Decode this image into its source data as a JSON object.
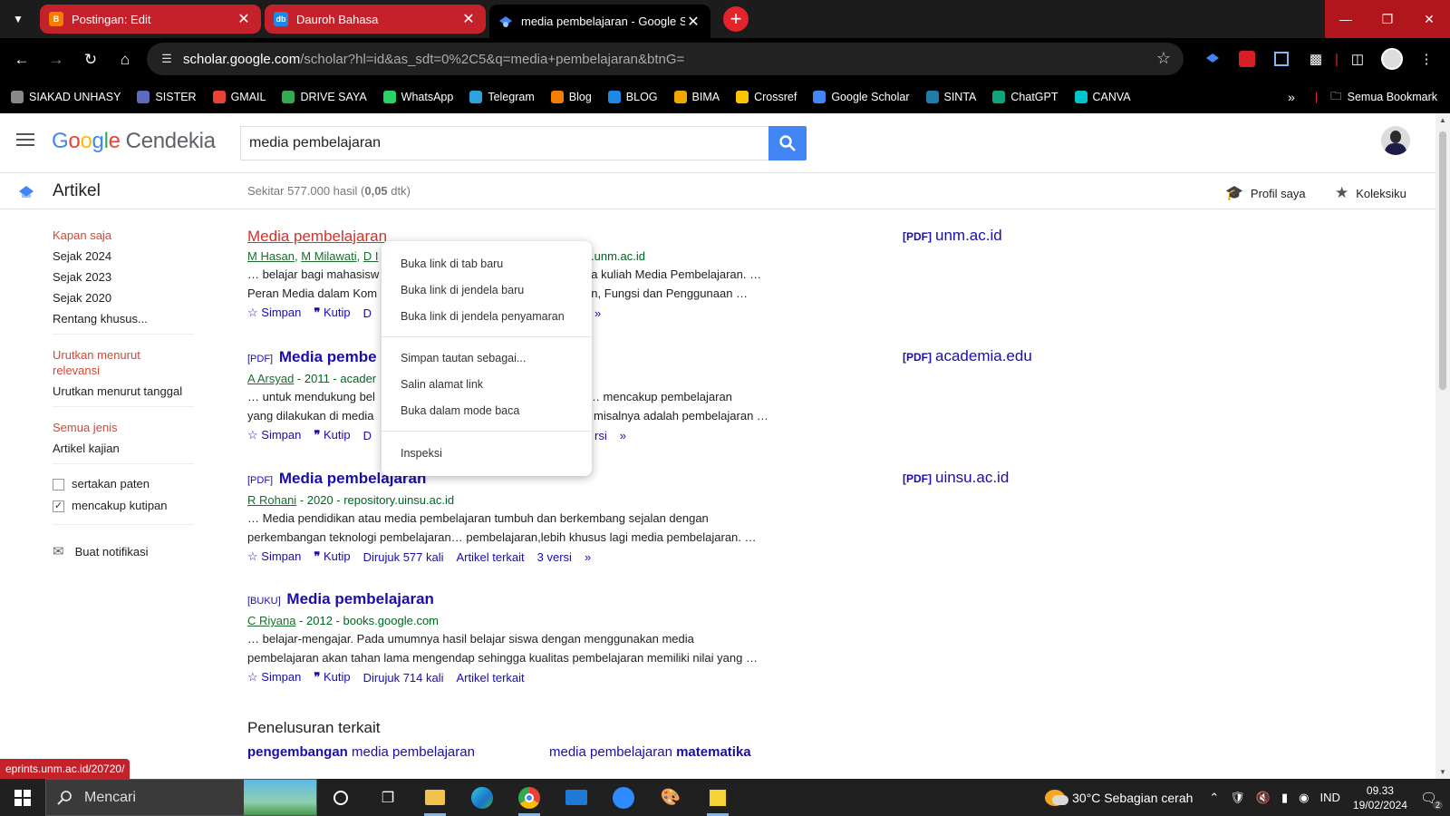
{
  "browser": {
    "tabs": [
      {
        "title": "Postingan: Edit",
        "favicon": "B",
        "color": "#f57d00"
      },
      {
        "title": "Dauroh Bahasa",
        "favicon": "db",
        "color": "#1e88e5"
      },
      {
        "title": "media pembelajaran - Google S",
        "favicon": "scholar",
        "color": "#4285f4"
      }
    ],
    "address": {
      "host": "scholar.google.com",
      "path": "/scholar?hl=id&as_sdt=0%2C5&q=media+pembelajaran&btnG="
    },
    "bookmarks": [
      {
        "label": "SIAKAD UNHASY",
        "icon": "ring-icon",
        "color": "#888"
      },
      {
        "label": "SISTER",
        "icon": "sister-icon",
        "color": "#5c6bc0"
      },
      {
        "label": "GMAIL",
        "icon": "gmail-icon",
        "color": "#ea4335"
      },
      {
        "label": "DRIVE SAYA",
        "icon": "drive-icon",
        "color": "#34a853"
      },
      {
        "label": "WhatsApp",
        "icon": "whatsapp-icon",
        "color": "#25d366"
      },
      {
        "label": "Telegram",
        "icon": "telegram-icon",
        "color": "#2aa3df"
      },
      {
        "label": "Blog",
        "icon": "blogger-icon",
        "color": "#f57d00"
      },
      {
        "label": "BLOG",
        "icon": "db-icon",
        "color": "#1e88e5"
      },
      {
        "label": "BIMA",
        "icon": "bima-icon",
        "color": "#f0a800"
      },
      {
        "label": "Crossref",
        "icon": "crossref-icon",
        "color": "#f7c600"
      },
      {
        "label": "Google Scholar",
        "icon": "scholar-icon",
        "color": "#4285f4"
      },
      {
        "label": "SINTA",
        "icon": "sinta-icon",
        "color": "#1f7ea8"
      },
      {
        "label": "ChatGPT",
        "icon": "chatgpt-icon",
        "color": "#10a37f"
      },
      {
        "label": "CANVA",
        "icon": "canva-icon",
        "color": "#00c4cc"
      }
    ],
    "all_bookmarks": "Semua Bookmark",
    "status_url": "eprints.unm.ac.id/20720/"
  },
  "scholar": {
    "logo": {
      "google": [
        "G",
        "o",
        "o",
        "g",
        "l",
        "e"
      ],
      "suffix": "Cendekia"
    },
    "query": "media pembelajaran",
    "section": "Artikel",
    "count_prefix": "Sekitar 577.000 hasil (",
    "count_time": "0,05",
    "count_suffix": " dtk)",
    "profile": "Profil saya",
    "library": "Koleksiku",
    "nav": {
      "time_active": "Kapan saja",
      "years": [
        "Sejak 2024",
        "Sejak 2023",
        "Sejak 2020",
        "Rentang khusus..."
      ],
      "sort_active": "Urutkan menurut relevansi",
      "sort_date": "Urutkan menurut tanggal",
      "type_active": "Semua jenis",
      "type_review": "Artikel kajian",
      "patents": "sertakan paten",
      "citations": "mencakup kutipan",
      "alert": "Buat notifikasi"
    },
    "results": [
      {
        "tag": "",
        "title": "Media pembelajaran",
        "authors": [
          "M Hasan",
          "M Milawati",
          "D I"
        ],
        "source_tail": "s.unm.ac.id",
        "snip1a": "… belajar bagi mahasisw",
        "snip1b": "a kuliah Media Pembelajaran. …",
        "snip2a": "Peran Media dalam Kom",
        "snip2b": "an, Fungsi dan Penggunaan …",
        "side_tag": "[PDF]",
        "side_domain": "unm.ac.id"
      },
      {
        "tag": "[PDF]",
        "title": "Media pembe",
        "author": "A Arsyad",
        "source": " - 2011 - acader",
        "snip1a": "… untuk mendukung bel",
        "snip1b": "… mencakup pembelajaran",
        "snip2a": "yang dilakukan di media",
        "snip2b": "l misalnya adalah pembelajaran …",
        "versions_tail": "rsi",
        "side_tag": "[PDF]",
        "side_domain": "academia.edu"
      },
      {
        "tag": "[PDF]",
        "title": "Media pembelajaran",
        "author": "R Rohani",
        "source": " - 2020 - repository.uinsu.ac.id",
        "snip1": "… Media pendidikan atau media pembelajaran tumbuh dan berkembang sejalan dengan",
        "snip2": "perkembangan teknologi pembelajaran… pembelajaran,lebih khusus lagi media pembelajaran. …",
        "cited": "Dirujuk 577 kali",
        "related": "Artikel terkait",
        "versions": "3 versi",
        "side_tag": "[PDF]",
        "side_domain": "uinsu.ac.id"
      },
      {
        "tag": "[BUKU]",
        "title": "Media pembelajaran",
        "author": "C Riyana",
        "source": " - 2012 - books.google.com",
        "snip1": "… belajar-mengajar. Pada umumnya hasil belajar siswa dengan menggunakan media",
        "snip2": "pembelajaran akan tahan lama mengendap sehingga kualitas pembelajaran memiliki nilai yang …",
        "cited": "Dirujuk 714 kali",
        "related": "Artikel terkait"
      }
    ],
    "actions": {
      "save": "Simpan",
      "cite": "Kutip",
      "cite_tail": "D"
    },
    "related_heading": "Penelusuran terkait",
    "related_links": [
      {
        "bold": "pengembangan",
        "rest": " media pembelajaran"
      },
      {
        "plain": "media pembelajaran ",
        "bold": "matematika"
      }
    ]
  },
  "context_menu": {
    "items": [
      "Buka link di tab baru",
      "Buka link di jendela baru",
      "Buka link di jendela penyamaran",
      "Simpan tautan sebagai...",
      "Salin alamat link",
      "Buka dalam mode baca",
      "Inspeksi"
    ]
  },
  "taskbar": {
    "search": "Mencari",
    "weather": "30°C  Sebagian cerah",
    "lang": "IND",
    "time": "09.33",
    "date": "19/02/2024",
    "notifications": "2"
  }
}
